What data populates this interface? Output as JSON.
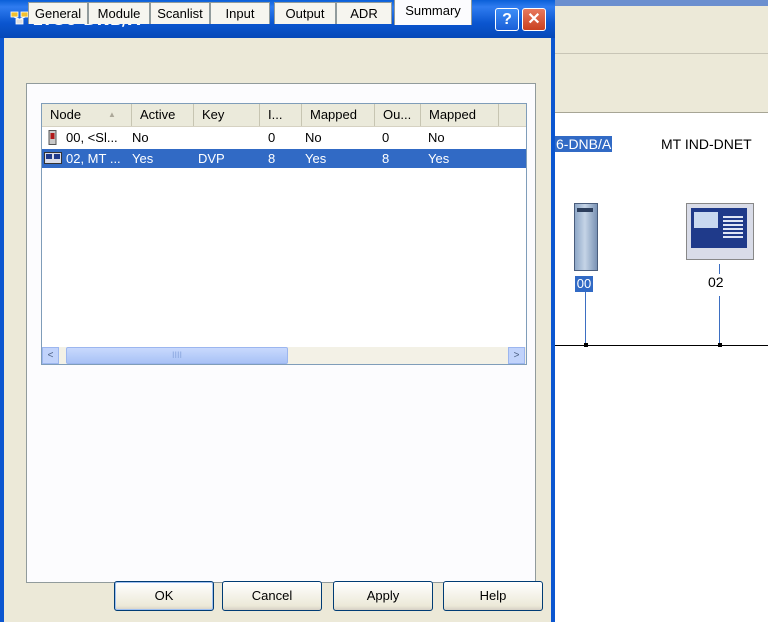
{
  "window": {
    "title": "1756-DNB/A",
    "title_icon": "network-module-icon",
    "help_glyph": "?",
    "close_glyph": "✕"
  },
  "tabs": [
    {
      "label": "General"
    },
    {
      "label": "Module"
    },
    {
      "label": "Scanlist"
    },
    {
      "label": "Input"
    },
    {
      "label": "Output"
    },
    {
      "label": "ADR"
    },
    {
      "label": "Summary",
      "active": true
    }
  ],
  "summary_list": {
    "columns": [
      "Node",
      "Active",
      "Key",
      "I...",
      "Mapped",
      "Ou...",
      "Mapped"
    ],
    "sort_glyph": "▲",
    "rows": [
      {
        "icon": "scanner-module-icon",
        "node": "00, <Sl...",
        "active": "No",
        "key": "",
        "input": "0",
        "input_mapped": "No",
        "output": "0",
        "output_mapped": "No",
        "selected": false
      },
      {
        "icon": "scale-device-icon",
        "node": "02, MT ...",
        "active": "Yes",
        "key": "DVP",
        "input": "8",
        "input_mapped": "Yes",
        "output": "8",
        "output_mapped": "Yes",
        "selected": true
      }
    ],
    "scroll_left_glyph": "<",
    "scroll_right_glyph": ">",
    "thumb_grip": "IIII"
  },
  "buttons": {
    "ok": "OK",
    "cancel": "Cancel",
    "apply": "Apply",
    "help": "Help"
  },
  "network_view": {
    "device1_label": "6-DNB/A",
    "device2_label": "MT IND-DNET",
    "node1_number": "00",
    "node2_number": "02"
  },
  "colors": {
    "selection": "#316ac5",
    "titlebar": "#0b56d0",
    "dialog_bg": "#ece9d8"
  }
}
